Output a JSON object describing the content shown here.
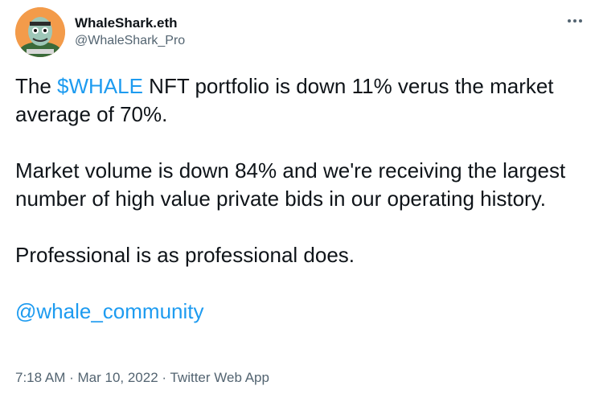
{
  "author": {
    "display_name": "WhaleShark.eth",
    "handle": "@WhaleShark_Pro"
  },
  "more_icon": "more-horizontal-icon",
  "tweet": {
    "p1": {
      "before": "The ",
      "cashtag": "$WHALE",
      "after": " NFT portfolio is down 11% verus the market average of 70%."
    },
    "p2": "Market volume is down 84% and we're receiving the largest number of high value private bids in our operating history.",
    "p3": "Professional is as professional does.",
    "mention": "@whale_community"
  },
  "meta": {
    "time": "7:18 AM",
    "date": "Mar 10, 2022",
    "source": "Twitter Web App",
    "separator": " · "
  },
  "colors": {
    "link": "#1d9bf0",
    "text": "#0f1419",
    "secondary": "#536471",
    "avatar_bg": "#f39b4a"
  }
}
